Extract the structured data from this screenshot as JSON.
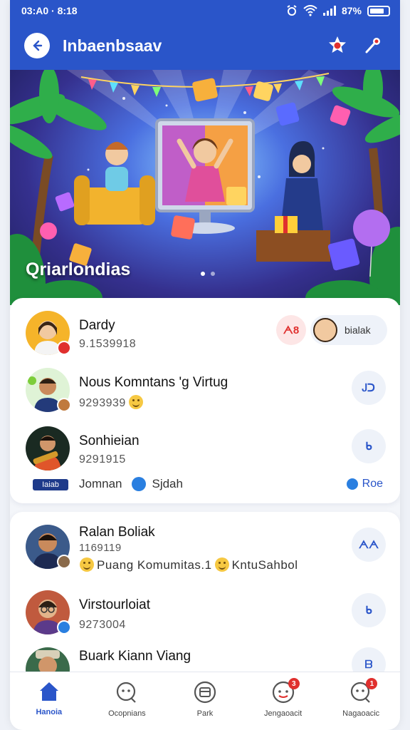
{
  "status_bar": {
    "time": "03:A0 · 8:18",
    "battery": "87%"
  },
  "header": {
    "title": "Inbaenbsaav"
  },
  "banner": {
    "caption": "Qriarlondias"
  },
  "contacts_card1": [
    {
      "name": "Dardy",
      "sub": "9.1539918",
      "button": "ᗅ8",
      "extra_pill": "bialak"
    },
    {
      "name": "Nous Komntans 'g Virtug",
      "sub": "9293939",
      "button": "Ꭻᑐ"
    },
    {
      "name": "Sonhieian",
      "sub": "9291915",
      "button": "ᑲ",
      "tag": "Iaiab",
      "line2_text": "Jomnan",
      "line2_text2": "Sjdah",
      "link": "Roe"
    }
  ],
  "contacts_card2": [
    {
      "name": "Ralan Boliak",
      "sub": "1169119",
      "line2_text": "Puang Komumitas.1",
      "line2_text2": "KntuSahbol",
      "button": "ᗅᗅ"
    },
    {
      "name": "Virstourloiat",
      "sub": "9273004",
      "button": "ᑲ"
    },
    {
      "name": "Buark Kiann Viang",
      "button": "ᗷ"
    }
  ],
  "bottom_nav": [
    {
      "label": "Hanoia",
      "icon": "home-icon",
      "active": true
    },
    {
      "label": "Ocopnians",
      "icon": "chat-icon"
    },
    {
      "label": "Park",
      "icon": "store-icon"
    },
    {
      "label": "Jengaoacit",
      "icon": "notify-icon",
      "badge": "3"
    },
    {
      "label": "Nagaoacic",
      "icon": "message-icon",
      "badge": "1"
    }
  ],
  "colors": {
    "primary": "#2a55c9",
    "badge": "#e0302e"
  }
}
